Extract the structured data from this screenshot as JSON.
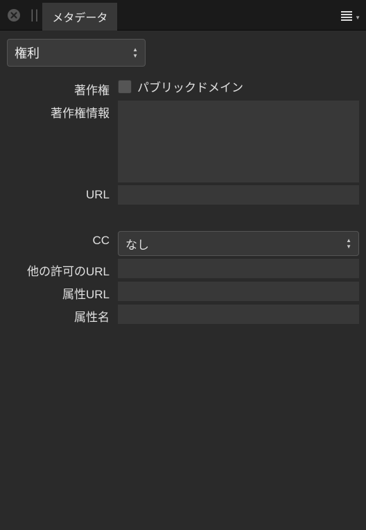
{
  "header": {
    "tab_label": "メタデータ"
  },
  "section_select": {
    "label": "権利"
  },
  "fields": {
    "copyright": {
      "label": "著作権",
      "checkbox_label": "パブリックドメイン",
      "checked": false
    },
    "copyright_info": {
      "label": "著作権情報",
      "value": ""
    },
    "url": {
      "label": "URL",
      "value": ""
    },
    "cc": {
      "label": "CC",
      "value": "なし"
    },
    "other_permission_url": {
      "label": "他の許可のURL",
      "value": ""
    },
    "attribute_url": {
      "label": "属性URL",
      "value": ""
    },
    "attribute_name": {
      "label": "属性名",
      "value": ""
    }
  }
}
